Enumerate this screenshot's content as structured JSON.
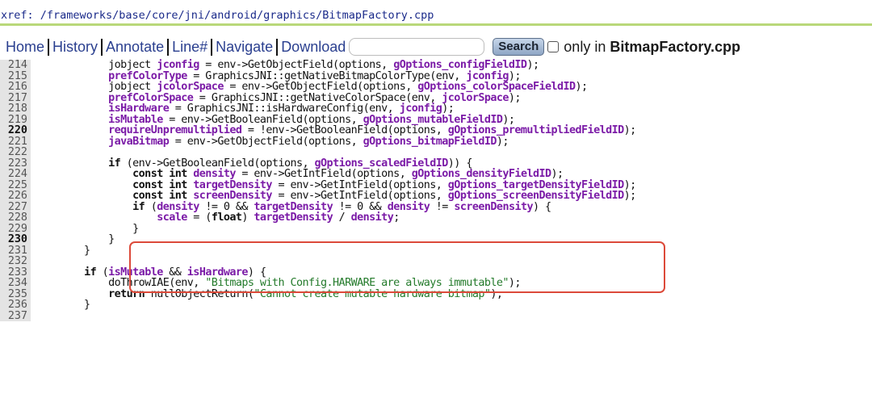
{
  "xref": {
    "label": "xref:",
    "path": " /frameworks/base/core/jni/android/graphics/BitmapFactory.cpp"
  },
  "nav": {
    "home": "Home",
    "history": "History",
    "annotate": "Annotate",
    "lineno": "Line#",
    "navigate": "Navigate",
    "download": "Download",
    "search_value": "",
    "search_button": "Search",
    "only_in": "only in",
    "only_file": "BitmapFactory.cpp"
  },
  "code": {
    "lines": [
      {
        "n": "214",
        "bold": false,
        "tokens": [
          [
            "p",
            "        jobject "
          ],
          [
            "v",
            "jconfig"
          ],
          [
            "p",
            " = env->GetObjectField(options, "
          ],
          [
            "v",
            "gOptions_configFieldID"
          ],
          [
            "p",
            ");"
          ]
        ]
      },
      {
        "n": "215",
        "bold": false,
        "tokens": [
          [
            "p",
            "        "
          ],
          [
            "v",
            "prefColorType"
          ],
          [
            "p",
            " = GraphicsJNI::getNativeBitmapColorType(env, "
          ],
          [
            "v",
            "jconfig"
          ],
          [
            "p",
            ");"
          ]
        ]
      },
      {
        "n": "216",
        "bold": false,
        "tokens": [
          [
            "p",
            "        jobject "
          ],
          [
            "v",
            "jcolorSpace"
          ],
          [
            "p",
            " = env->GetObjectField(options, "
          ],
          [
            "v",
            "gOptions_colorSpaceFieldID"
          ],
          [
            "p",
            ");"
          ]
        ]
      },
      {
        "n": "217",
        "bold": false,
        "tokens": [
          [
            "p",
            "        "
          ],
          [
            "v",
            "prefColorSpace"
          ],
          [
            "p",
            " = GraphicsJNI::getNativeColorSpace(env, "
          ],
          [
            "v",
            "jcolorSpace"
          ],
          [
            "p",
            ");"
          ]
        ]
      },
      {
        "n": "218",
        "bold": false,
        "tokens": [
          [
            "p",
            "        "
          ],
          [
            "v",
            "isHardware"
          ],
          [
            "p",
            " = GraphicsJNI::isHardwareConfig(env, "
          ],
          [
            "v",
            "jconfig"
          ],
          [
            "p",
            ");"
          ]
        ]
      },
      {
        "n": "219",
        "bold": false,
        "tokens": [
          [
            "p",
            "        "
          ],
          [
            "v",
            "isMutable"
          ],
          [
            "p",
            " = env->GetBooleanField(options, "
          ],
          [
            "v",
            "gOptions_mutableFieldID"
          ],
          [
            "p",
            ");"
          ]
        ]
      },
      {
        "n": "220",
        "bold": true,
        "tokens": [
          [
            "p",
            "        "
          ],
          [
            "v",
            "requireUnpremultiplied"
          ],
          [
            "p",
            " = !env->GetBooleanField(options, "
          ],
          [
            "v",
            "gOptions_premultipliedFieldID"
          ],
          [
            "p",
            ");"
          ]
        ]
      },
      {
        "n": "221",
        "bold": false,
        "tokens": [
          [
            "p",
            "        "
          ],
          [
            "v",
            "javaBitmap"
          ],
          [
            "p",
            " = env->GetObjectField(options, "
          ],
          [
            "v",
            "gOptions_bitmapFieldID"
          ],
          [
            "p",
            ");"
          ]
        ]
      },
      {
        "n": "222",
        "bold": false,
        "tokens": []
      },
      {
        "n": "223",
        "bold": false,
        "tokens": [
          [
            "p",
            "        "
          ],
          [
            "k",
            "if"
          ],
          [
            "p",
            " (env->GetBooleanField(options, "
          ],
          [
            "v",
            "gOptions_scaledFieldID"
          ],
          [
            "p",
            ")) {"
          ]
        ]
      },
      {
        "n": "224",
        "bold": false,
        "tokens": [
          [
            "p",
            "            "
          ],
          [
            "k",
            "const int"
          ],
          [
            "p",
            " "
          ],
          [
            "v",
            "density"
          ],
          [
            "p",
            " = env->GetIntField(options, "
          ],
          [
            "v",
            "gOptions_densityFieldID"
          ],
          [
            "p",
            ");"
          ]
        ]
      },
      {
        "n": "225",
        "bold": false,
        "tokens": [
          [
            "p",
            "            "
          ],
          [
            "k",
            "const int"
          ],
          [
            "p",
            " "
          ],
          [
            "v",
            "targetDensity"
          ],
          [
            "p",
            " = env->GetIntField(options, "
          ],
          [
            "v",
            "gOptions_targetDensityFieldID"
          ],
          [
            "p",
            ");"
          ]
        ]
      },
      {
        "n": "226",
        "bold": false,
        "tokens": [
          [
            "p",
            "            "
          ],
          [
            "k",
            "const int"
          ],
          [
            "p",
            " "
          ],
          [
            "v",
            "screenDensity"
          ],
          [
            "p",
            " = env->GetIntField(options, "
          ],
          [
            "v",
            "gOptions_screenDensityFieldID"
          ],
          [
            "p",
            ");"
          ]
        ]
      },
      {
        "n": "227",
        "bold": false,
        "tokens": [
          [
            "p",
            "            "
          ],
          [
            "k",
            "if"
          ],
          [
            "p",
            " ("
          ],
          [
            "v",
            "density"
          ],
          [
            "p",
            " != 0 && "
          ],
          [
            "v",
            "targetDensity"
          ],
          [
            "p",
            " != 0 && "
          ],
          [
            "v",
            "density"
          ],
          [
            "p",
            " != "
          ],
          [
            "v",
            "screenDensity"
          ],
          [
            "p",
            ") {"
          ]
        ]
      },
      {
        "n": "228",
        "bold": false,
        "tokens": [
          [
            "p",
            "                "
          ],
          [
            "v",
            "scale"
          ],
          [
            "p",
            " = ("
          ],
          [
            "k",
            "float"
          ],
          [
            "p",
            ") "
          ],
          [
            "v",
            "targetDensity"
          ],
          [
            "p",
            " / "
          ],
          [
            "v",
            "density"
          ],
          [
            "p",
            ";"
          ]
        ]
      },
      {
        "n": "229",
        "bold": false,
        "tokens": [
          [
            "p",
            "            }"
          ]
        ]
      },
      {
        "n": "230",
        "bold": true,
        "tokens": [
          [
            "p",
            "        }"
          ]
        ]
      },
      {
        "n": "231",
        "bold": false,
        "tokens": [
          [
            "p",
            "    }"
          ]
        ]
      },
      {
        "n": "232",
        "bold": false,
        "tokens": []
      },
      {
        "n": "233",
        "bold": false,
        "tokens": [
          [
            "p",
            "    "
          ],
          [
            "k",
            "if"
          ],
          [
            "p",
            " ("
          ],
          [
            "v",
            "isMutable"
          ],
          [
            "p",
            " && "
          ],
          [
            "v",
            "isHardware"
          ],
          [
            "p",
            ") {"
          ]
        ]
      },
      {
        "n": "234",
        "bold": false,
        "tokens": [
          [
            "p",
            "        doThrowIAE(env, "
          ],
          [
            "s",
            "\"Bitmaps with Config.HARWARE are always immutable\""
          ],
          [
            "p",
            ");"
          ]
        ]
      },
      {
        "n": "235",
        "bold": false,
        "tokens": [
          [
            "p",
            "        "
          ],
          [
            "k",
            "return"
          ],
          [
            "p",
            " nullObjectReturn("
          ],
          [
            "s",
            "\"Cannot create mutable hardware bitmap\""
          ],
          [
            "p",
            ");"
          ]
        ]
      },
      {
        "n": "236",
        "bold": false,
        "tokens": [
          [
            "p",
            "    }"
          ]
        ]
      },
      {
        "n": "237",
        "bold": false,
        "tokens": []
      }
    ]
  },
  "colors": {
    "variable": "#7b1ba7",
    "string": "#237a2a",
    "highlight_border": "#dc4a3a",
    "xref_underline": "#b9d87a"
  }
}
